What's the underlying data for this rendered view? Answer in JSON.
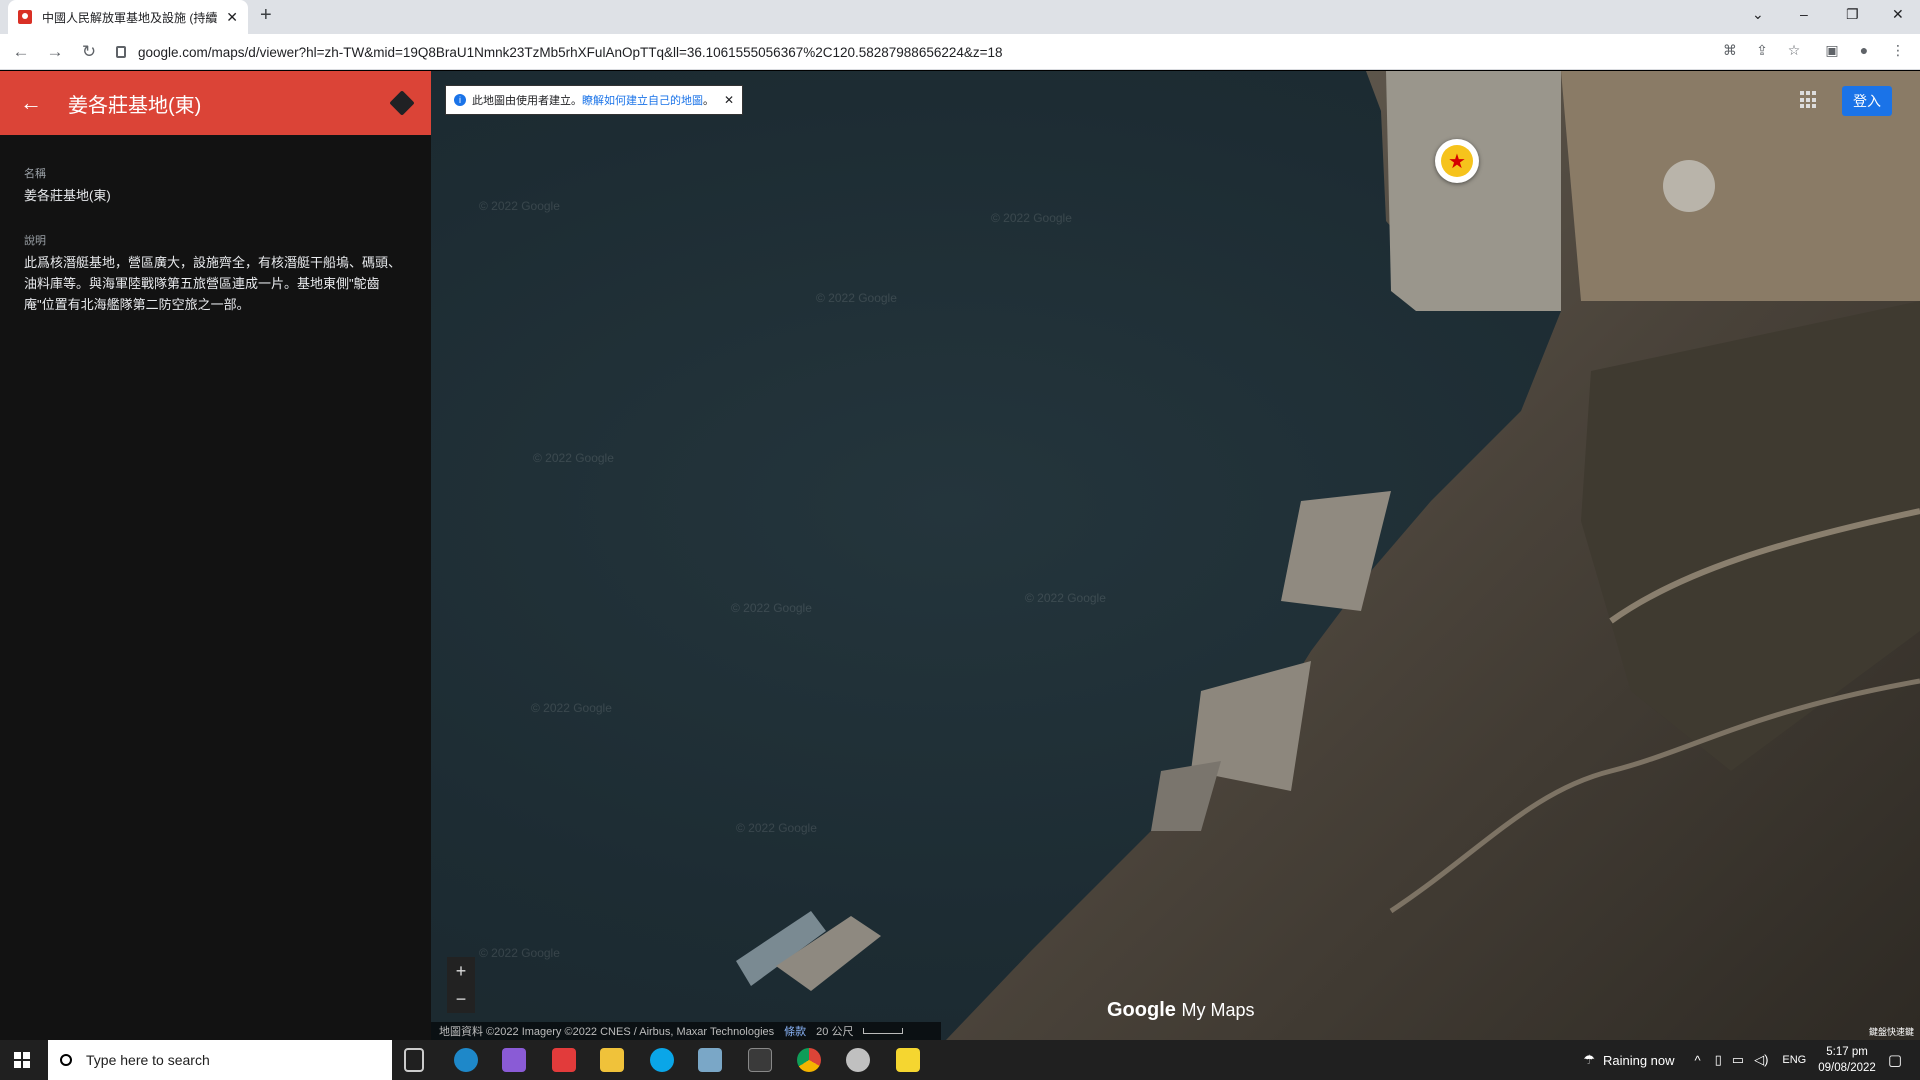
{
  "browser": {
    "tab_title": "中國人民解放軍基地及設施 (持續",
    "url": "google.com/maps/d/viewer?hl=zh-TW&mid=19Q8BraU1Nmnk23TzMb5rhXFulAnOpTTq&ll=36.1061555056367%2C120.58287988656224&z=18"
  },
  "panel": {
    "title": "姜各莊基地(東)",
    "name_label": "名稱",
    "name_value": "姜各莊基地(東)",
    "desc_label": "說明",
    "desc_value": "此爲核潛艇基地，營區廣大，設施齊全，有核潛艇干船塢、碼頭、油料庫等。與海軍陸戰隊第五旅營區連成一片。基地東側\"鴕齒庵\"位置有北海艦隊第二防空旅之一部。"
  },
  "map": {
    "notice_text": "此地圖由使用者建立。",
    "notice_link": "瞭解如何建立自己的地圖",
    "notice_after": "。",
    "signin_label": "登入",
    "zoom_in": "+",
    "zoom_out": "−",
    "attribution": "地圖資料 ©2022 Imagery ©2022 CNES / Airbus, Maxar Technologies",
    "terms": "條款",
    "scale": "20 公尺",
    "logo_google": "Google",
    "logo_mymaps": "My Maps",
    "watermark": "© 2022 Google",
    "shortcut": "鍵盤快速鍵"
  },
  "taskbar": {
    "search_placeholder": "Type here to search",
    "weather": "Raining now",
    "lang": "ENG",
    "time": "5:17 pm",
    "date": "09/08/2022"
  }
}
